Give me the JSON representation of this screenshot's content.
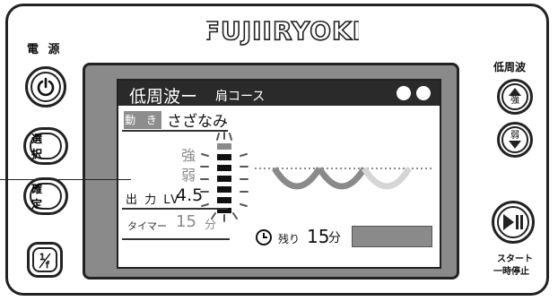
{
  "brand": {
    "logo_text": "FUJIIRYOKI"
  },
  "left_buttons": {
    "power_label": "電 源",
    "select_label": "選 択",
    "confirm_label": "確 定",
    "fraction_label": "1/f"
  },
  "right_buttons": {
    "low_freq_label": "低周波",
    "strong_label": "強",
    "weak_label": "弱",
    "start_label_line1": "スタート",
    "start_label_line2": "一時停止"
  },
  "screen": {
    "title_main": "低周波ー",
    "title_sub": "肩コース",
    "movement_tag": "動 き",
    "movement_value": "さざなみ",
    "strength_strong": "強",
    "strength_weak": "弱",
    "output_label": "出 力 LV",
    "output_level": "4.5",
    "timer_label": "タイマー",
    "timer_value": "15",
    "timer_unit": "分",
    "remaining_label": "残り",
    "remaining_value": "15",
    "remaining_unit": "分"
  },
  "colors": {
    "bezel": "#8a8a8a",
    "titlebar": "#2a2a2a",
    "wave_active": "#8a8a8a",
    "wave_inactive": "#d5d5d5"
  },
  "icons": {
    "power": "power-icon",
    "up": "triangle-up-icon",
    "down": "triangle-down-icon",
    "play_pause": "play-pause-icon",
    "clock": "clock-icon"
  }
}
